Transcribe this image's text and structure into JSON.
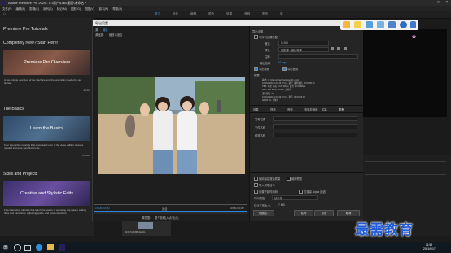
{
  "window": {
    "title": "Adobe Premiere Pro 2020 - C:\\用户\\Dac\\桌面\\未命名 *"
  },
  "menu": [
    "文件(F)",
    "编辑(E)",
    "剪辑(C)",
    "序列(S)",
    "标记(M)",
    "图形(G)",
    "视图(V)",
    "窗口(W)",
    "帮助(H)"
  ],
  "workspaces": [
    "学习",
    "组件",
    "编辑",
    "颜色",
    "效果",
    "音频",
    "图形",
    "库"
  ],
  "learn": {
    "title": "Premiere Pro Tutorials",
    "section1": "Completely New? Start Here!",
    "card1": "Premiere Pro Overview",
    "desc1": "A two-minute overview of the interface and the essentials needed to get started.",
    "mins1": "2 min",
    "section2": "The Basics",
    "card2": "Learn the Basics",
    "desc2": "Four interactive tutorials that cover each step of the video editing process needed to create your first movie.",
    "mins2": "15 min",
    "section3": "Skills and Projects",
    "card3": "Creative and Stylistic Edits",
    "desc3": "Five interactive tutorials that teach the basics of adjusting clip speed, adding titles and transitions, adjusting audio, and color correction."
  },
  "dialog": {
    "title": "导出设置",
    "tab_source": "源",
    "tab_output": "输出",
    "output_label": "源缩放:",
    "output_value": "缩放以适合",
    "timecode_start": "00;00;00;00",
    "timecode_end": "00;00;05;00",
    "fit_label": "适合",
    "source_range_label": "源范围:",
    "source_range_value": "整个剪辑(入点/出点)",
    "export_settings_header": "导出设置",
    "match_seq": "与序列设置匹配",
    "format_label": "格式:",
    "format_value": "H.264",
    "preset_label": "预设:",
    "preset_value": "匹配源 - 高比特率",
    "comment_label": "注释:",
    "output_name_label": "输出名称:",
    "output_name_value": "01.mp4",
    "export_video": "导出视频",
    "export_audio": "导出音频",
    "summary_header": "摘要",
    "summary_output": "输出: C:\\Users\\Dac\\Desktop\\01.mp4",
    "summary_output2": "1080x1920 (1.0), 29.97 fps, 逐行, 硬件编码, 00:00:05:00",
    "summary_output3": "VBR, 1 次, 目标 10.00 Mbps, 最大 12.00 Mbps",
    "summary_output4": "AAC, 320 kbps, 48 kHz, 立体声",
    "summary_source": "源: 剪辑, 01",
    "summary_source2": "1080x1920 (1.0), 29.97 fps, 逐行, 00:00:05:00",
    "summary_source3": "48000 Hz, 立体声",
    "tabs": [
      "效果",
      "视频",
      "音频",
      "多路复用器",
      "字幕",
      "发布"
    ],
    "active_tab": "发布",
    "field1": "发布位置",
    "field2": "文件名称",
    "field3": "频道名称",
    "use_max_quality": "使用最高渲染质量",
    "use_preview": "使用预览",
    "import_project": "导入到项目中",
    "set_start_timecode": "设置开始时间码",
    "render_alpha": "仅渲染 Alpha 通道",
    "time_interp_label": "时间插值:",
    "time_interp_value": "帧采样",
    "file_size_label": "估计文件大小:",
    "file_size_value": "7 MB",
    "btn_metadata": "元数据...",
    "btn_queue": "队列",
    "btn_export": "导出",
    "btn_cancel": "取消"
  },
  "timeline": {
    "clip": "0c9c7e8c9ffb4ad0c..."
  },
  "taskbar": {
    "time": "11:58",
    "date": "2021/6/17"
  },
  "watermark": "最需教育",
  "colors": {
    "accent": "#2e86de",
    "watermark": "#1f5bd6"
  }
}
